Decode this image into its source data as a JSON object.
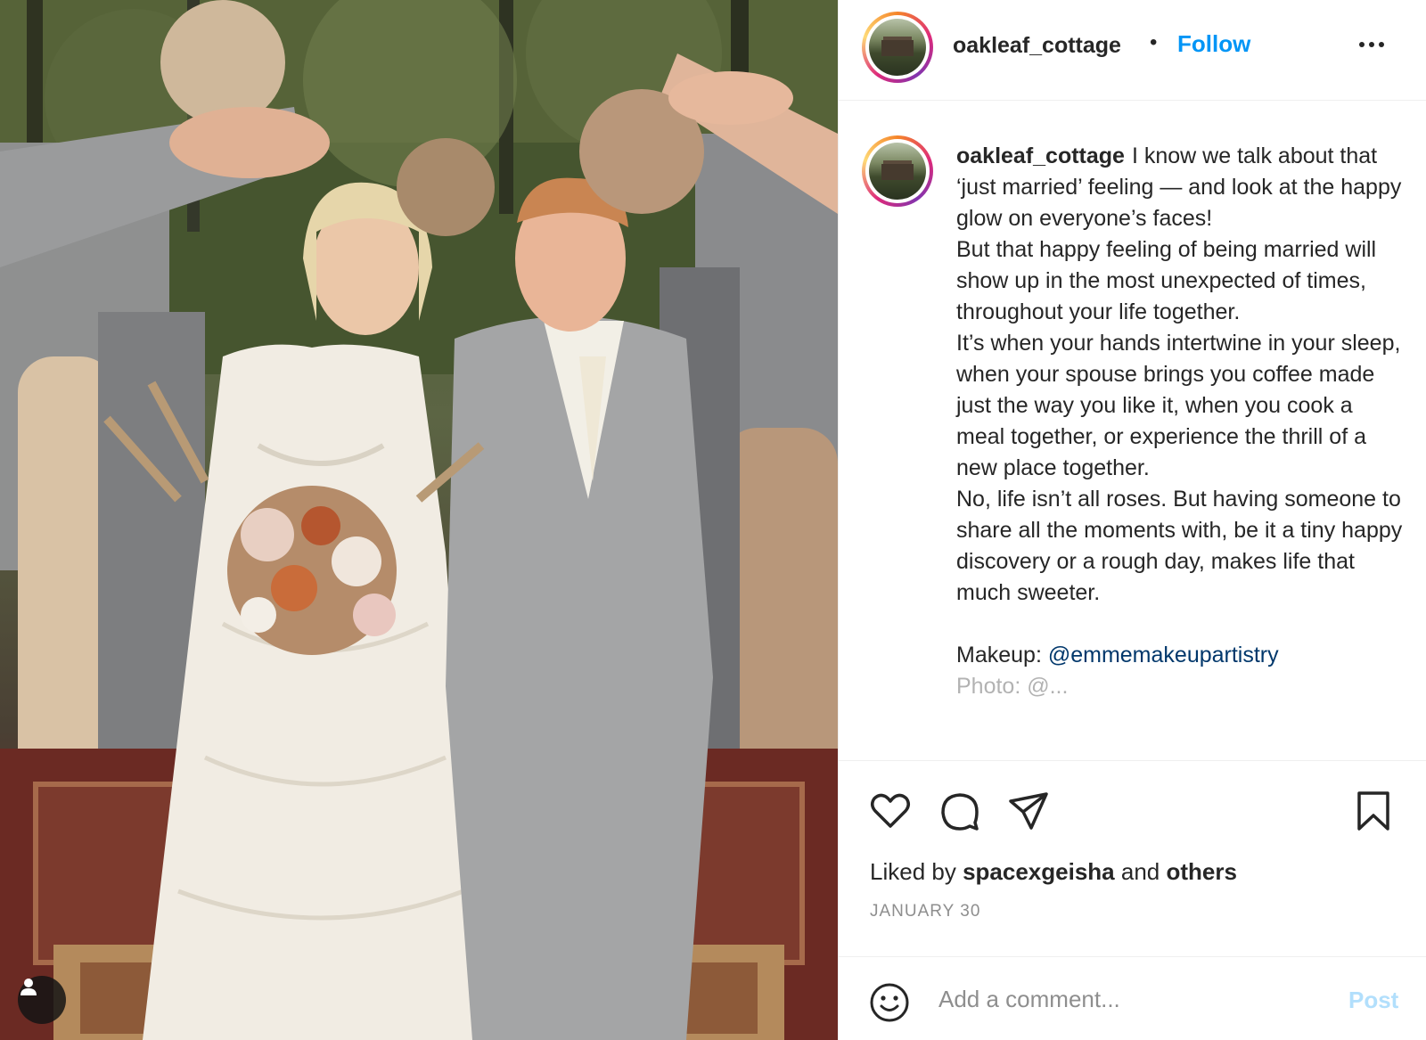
{
  "post": {
    "image_alt": "Wedding couple walking through a tunnel of raised hands and dried-flower bouquets"
  },
  "header": {
    "username": "oakleaf_cottage",
    "separator": "•",
    "follow_label": "Follow",
    "more_icon": "more-horizontal-icon"
  },
  "caption": {
    "username": "oakleaf_cottage",
    "lines": [
      "I know we talk about that ‘just married’ feeling — and look at the happy glow on everyone’s faces!",
      "But that happy feeling of being married will show up in the most unexpected of times, throughout your life together.",
      "It’s when your hands intertwine in your sleep, when your spouse brings you coffee made just the way you like it, when you cook a meal together, or experience the thrill of a new place together.",
      "No, life isn’t all roses. But having someone to share all the moments with, be it a tiny happy discovery or a rough day, makes life that much sweeter."
    ],
    "credit_label": "Makeup: ",
    "credit_mention": "@emmemakeupartistry",
    "cut_off_line": "Photo: @..."
  },
  "actions": {
    "like_icon": "heart-icon",
    "comment_icon": "comment-icon",
    "share_icon": "share-icon",
    "save_icon": "bookmark-icon"
  },
  "likes": {
    "prefix": "Liked by ",
    "user": "spacexgeisha",
    "middle": " and ",
    "others": "others"
  },
  "date": "JANUARY 30",
  "comment": {
    "placeholder": "Add a comment...",
    "post_label": "Post",
    "emoji_icon": "smiley-icon"
  },
  "colors": {
    "accent": "#0095f6",
    "mention": "#00376b",
    "post_disabled": "#b2dffc",
    "muted": "#8e8e8e",
    "text": "#262626"
  }
}
